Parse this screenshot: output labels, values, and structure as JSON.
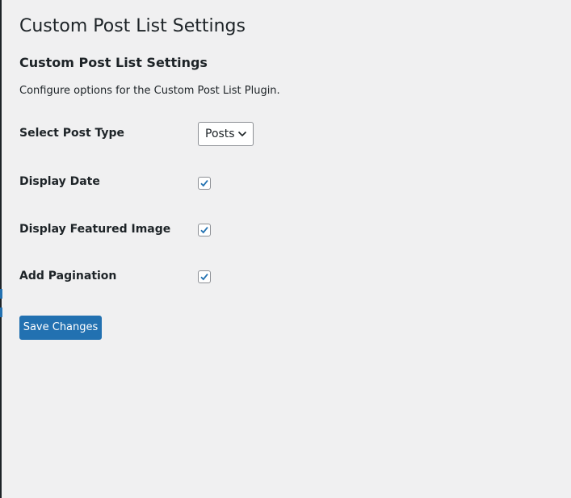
{
  "page": {
    "title": "Custom Post List Settings"
  },
  "section": {
    "title": "Custom Post List Settings",
    "description": "Configure options for the Custom Post List Plugin."
  },
  "fields": {
    "post_type": {
      "label": "Select Post Type",
      "value": "Posts"
    },
    "display_date": {
      "label": "Display Date",
      "checked": true
    },
    "display_featured_image": {
      "label": "Display Featured Image",
      "checked": true
    },
    "add_pagination": {
      "label": "Add Pagination",
      "checked": true
    }
  },
  "actions": {
    "save_label": "Save Changes"
  },
  "icons": {
    "dropdown": "chevron-down-icon",
    "check": "checkmark-icon"
  },
  "colors": {
    "background": "#f0f0f1",
    "primary_button": "#2271b1",
    "text": "#1d2327",
    "checkmark": "#2271b1"
  }
}
